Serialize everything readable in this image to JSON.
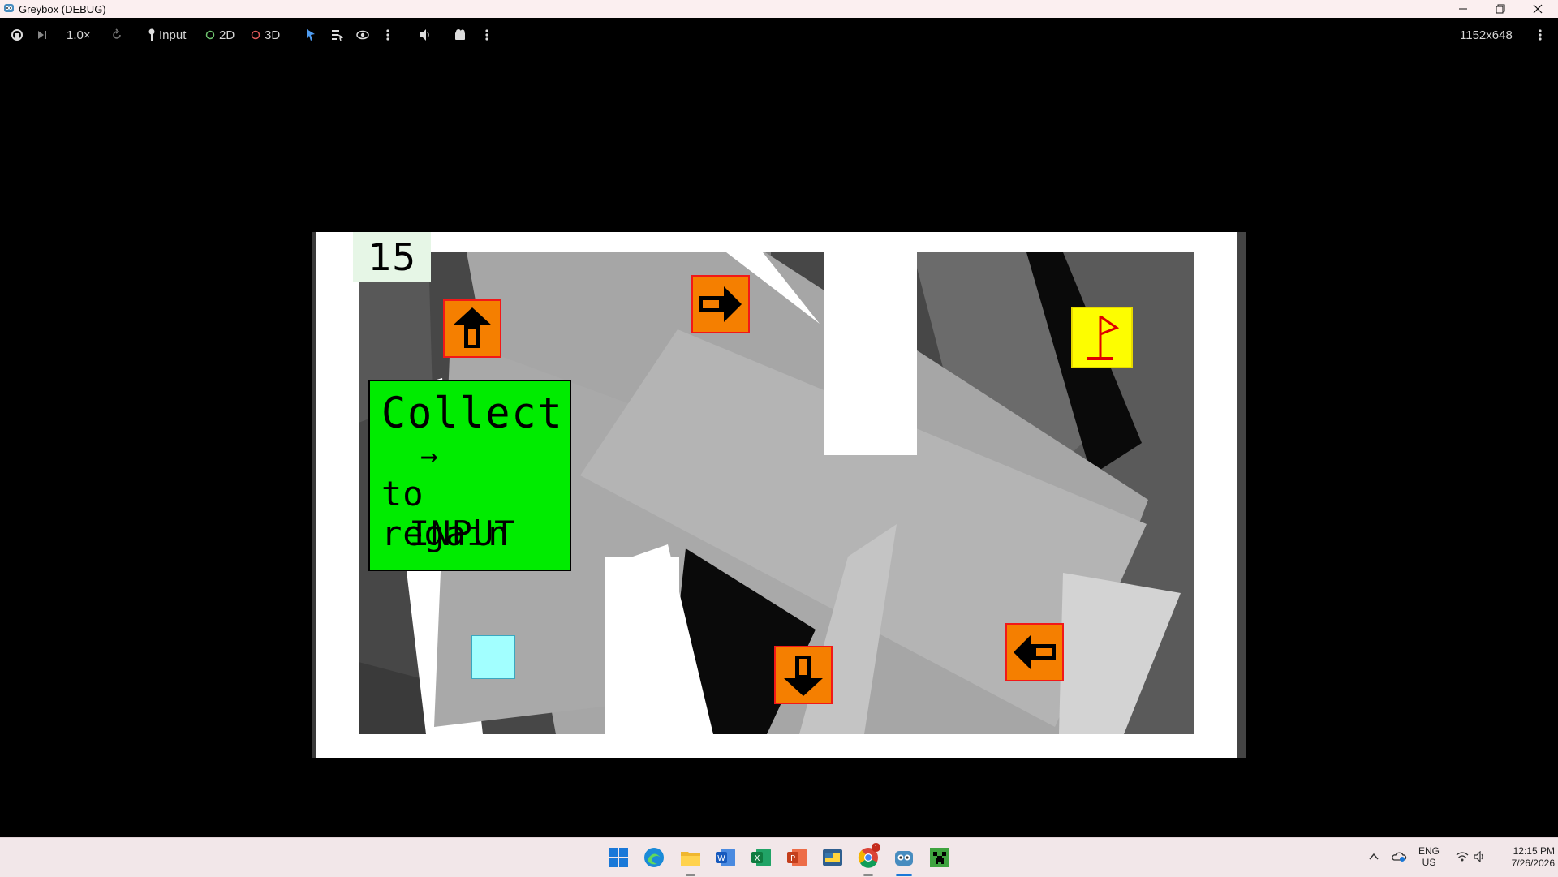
{
  "window": {
    "title": "Greybox (DEBUG)",
    "controls": {
      "minimize_icon": "minimize-icon",
      "maximize_icon": "restore-icon",
      "close_icon": "close-icon"
    }
  },
  "toolbar": {
    "speed": "1.0×",
    "input_label": "Input",
    "label_2d": "2D",
    "label_3d": "3D",
    "resolution": "1152x648",
    "colors": {
      "dot_2d": "#6fc36f",
      "dot_3d": "#e05a5a",
      "select_arrow": "#4f9cf0"
    }
  },
  "game": {
    "counter": "15",
    "hint": {
      "line1": "Collect",
      "line2": "→",
      "line3": "to regain",
      "line4": "INPUT"
    },
    "pickups": [
      {
        "name": "up-arrow-pickup",
        "direction": "up"
      },
      {
        "name": "right-arrow-pickup",
        "direction": "right"
      },
      {
        "name": "down-arrow-pickup",
        "direction": "down"
      },
      {
        "name": "left-arrow-pickup",
        "direction": "left"
      }
    ],
    "goal_icon": "flag-icon",
    "colors": {
      "pickup_fill": "#f57f00",
      "pickup_border": "#f21818",
      "goal_fill": "#fdfd00",
      "hint_fill": "#00ec00",
      "player_fill": "#a2ffff"
    }
  },
  "taskbar": {
    "apps": [
      "start-icon",
      "edge-icon",
      "file-explorer-icon",
      "word-icon",
      "excel-icon",
      "powerpoint-icon",
      "python-icon",
      "chrome-icon",
      "godot-icon",
      "minecraft-icon"
    ],
    "chrome_badge": "1",
    "tray": {
      "lang1": "ENG",
      "lang2": "US",
      "time": "12:15 PM",
      "date": "7/26/2026"
    }
  }
}
